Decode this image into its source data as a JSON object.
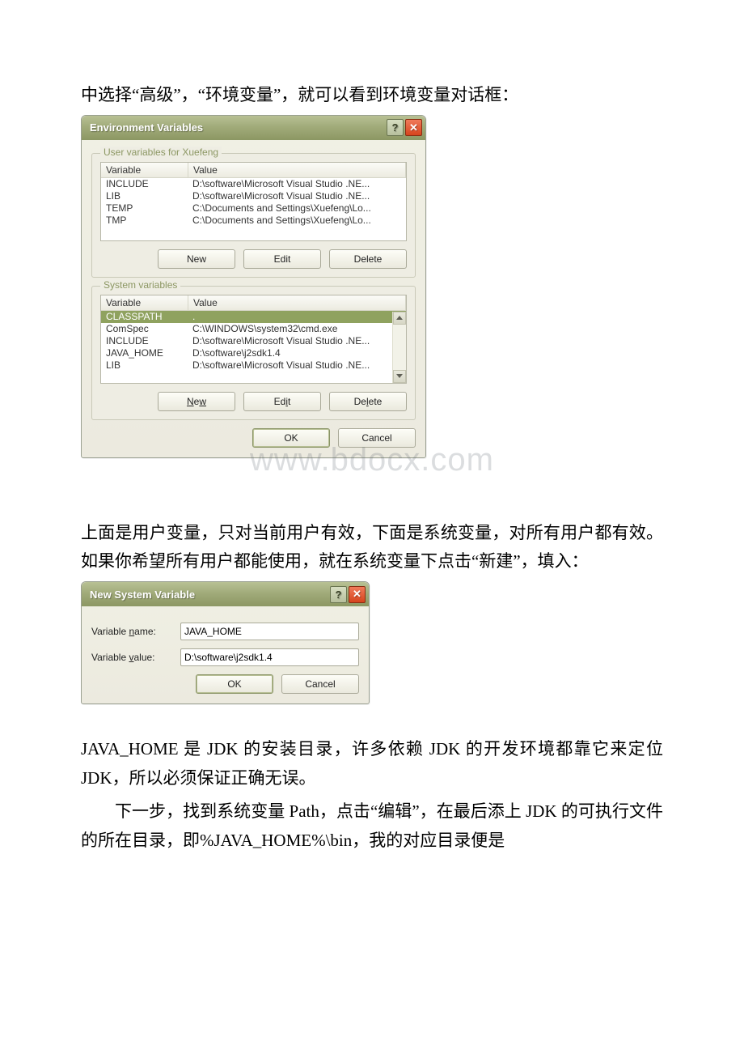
{
  "para1": "中选择“高级”，“环境变量”，就可以看到环境变量对话框：",
  "para2": "上面是用户变量，只对当前用户有效，下面是系统变量，对所有用户都有效。如果你希望所有用户都能使用，就在系统变量下点击“新建”，填入：",
  "para3": "JAVA_HOME 是 JDK 的安装目录，许多依赖 JDK 的开发环境都靠它来定位 JDK，所以必须保证正确无误。",
  "para4": "下一步，找到系统变量 Path，点击“编辑”，在最后添上 JDK 的可执行文件的所在目录，即%JAVA_HOME%\\bin，我的对应目录便是",
  "watermark": "www.bdocx.com",
  "env_dialog": {
    "title": "Environment Variables",
    "user_legend": "User variables for Xuefeng",
    "sys_legend": "System variables",
    "col_variable": "Variable",
    "col_value": "Value",
    "user_rows": [
      {
        "var": "INCLUDE",
        "val": "D:\\software\\Microsoft Visual Studio .NE..."
      },
      {
        "var": "LIB",
        "val": "D:\\software\\Microsoft Visual Studio .NE..."
      },
      {
        "var": "TEMP",
        "val": "C:\\Documents and Settings\\Xuefeng\\Lo..."
      },
      {
        "var": "TMP",
        "val": "C:\\Documents and Settings\\Xuefeng\\Lo..."
      }
    ],
    "sys_rows": [
      {
        "var": "CLASSPATH",
        "val": ".",
        "selected": true
      },
      {
        "var": "ComSpec",
        "val": "C:\\WINDOWS\\system32\\cmd.exe"
      },
      {
        "var": "INCLUDE",
        "val": "D:\\software\\Microsoft Visual Studio .NE..."
      },
      {
        "var": "JAVA_HOME",
        "val": "D:\\software\\j2sdk1.4"
      },
      {
        "var": "LIB",
        "val": "D:\\software\\Microsoft Visual Studio .NE..."
      }
    ],
    "btn_new": "New",
    "btn_edit": "Edit",
    "btn_delete": "Delete",
    "btn_ok": "OK",
    "btn_cancel": "Cancel"
  },
  "new_dialog": {
    "title": "New System Variable",
    "label_name": "Variable name:",
    "label_value": "Variable value:",
    "name_value": "JAVA_HOME",
    "value_value": "D:\\software\\j2sdk1.4",
    "btn_ok": "OK",
    "btn_cancel": "Cancel"
  }
}
